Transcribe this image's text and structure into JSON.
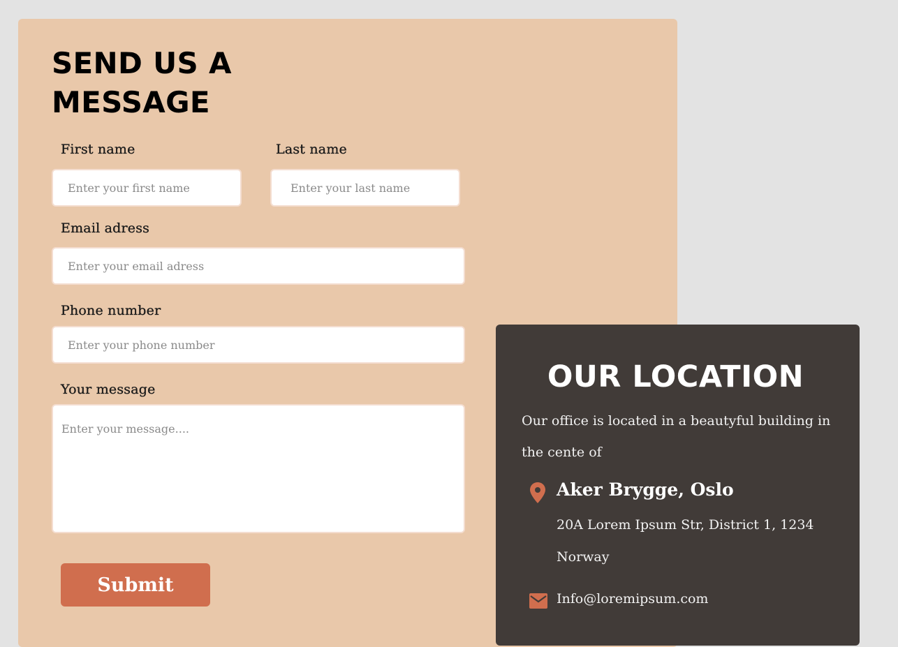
{
  "form": {
    "title": "SEND US A\nMESSAGE",
    "first_name": {
      "label": "First name",
      "placeholder": "Enter your first name",
      "value": ""
    },
    "last_name": {
      "label": "Last name",
      "placeholder": "Enter your last name",
      "value": ""
    },
    "email": {
      "label": "Email adress",
      "placeholder": "Enter your email adress",
      "value": ""
    },
    "phone": {
      "label": "Phone number",
      "placeholder": "Enter your phone number",
      "value": ""
    },
    "message": {
      "label": "Your message",
      "placeholder": "Enter your message....",
      "value": ""
    },
    "submit_label": "Submit"
  },
  "location": {
    "title": "OUR LOCATION",
    "description": "Our office is located in a beautyful building in the cente of",
    "place_name": "Aker Brygge, Oslo",
    "address": "20A Lorem Ipsum Str, District 1, 1234 Norway",
    "email": "Info@loremipsum.com",
    "icons": {
      "location": "map-pin-icon",
      "email": "envelope-icon"
    }
  },
  "colors": {
    "page_background": "#e3e3e3",
    "form_background": "#e9c8aa",
    "location_background": "#413b38",
    "accent": "#d06e4e"
  }
}
